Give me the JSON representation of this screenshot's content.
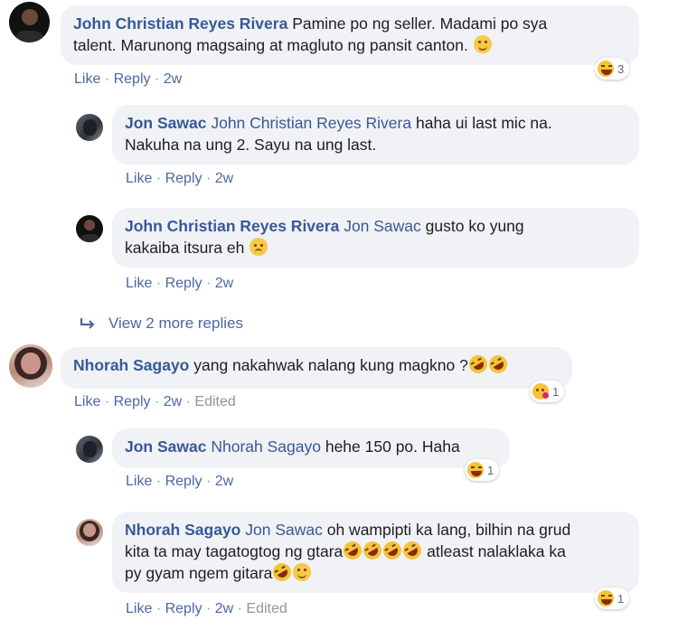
{
  "comments": [
    {
      "author": "John Christian Reyes Rivera",
      "text_line1": "Pamine po ng seller. Madami po sya",
      "text_line2": "talent. Marunong magsaing at magluto ng pansit canton.",
      "trail_emoji": "smile-emoji",
      "actions": {
        "like": "Like",
        "reply": "Reply",
        "time": "2w"
      },
      "reaction": {
        "icon": "laugh-reaction-icon",
        "count": "3"
      }
    },
    {
      "author": "Jon Sawac",
      "mention": "John Christian Reyes Rivera",
      "text_line1": "haha ui last mic na.",
      "text_line2": "Nakuha na ung 2. Sayu na ung last.",
      "actions": {
        "like": "Like",
        "reply": "Reply",
        "time": "2w"
      }
    },
    {
      "author": "John Christian Reyes Rivera",
      "mention": "Jon Sawac",
      "text_line1": "gusto ko yung",
      "text_line2": "kakaiba itsura eh",
      "trail_emoji": "sad-emoji",
      "actions": {
        "like": "Like",
        "reply": "Reply",
        "time": "2w"
      }
    },
    {
      "view_more": "View 2 more replies"
    },
    {
      "author": "Nhorah Sagayo",
      "text_line1": "yang nakahwak nalang kung magkno ?",
      "trail_emoji": "rofl-emoji",
      "actions": {
        "like": "Like",
        "reply": "Reply",
        "time": "2w",
        "edited": "Edited"
      },
      "reaction": {
        "icon": "wow-haha-reaction-icon",
        "count": "1"
      }
    },
    {
      "author": "Jon Sawac",
      "mention": "Nhorah Sagayo",
      "text_line1": "hehe 150 po. Haha",
      "actions": {
        "like": "Like",
        "reply": "Reply",
        "time": "2w"
      },
      "reaction": {
        "icon": "laugh-reaction-icon",
        "count": "1"
      }
    },
    {
      "author": "Nhorah Sagayo",
      "mention": "Jon Sawac",
      "text_line1": "oh wampipti ka lang, bilhin na grud",
      "text_line2a": "kita ta may tagatogtog ng gtara",
      "text_line2b": "atleast nalaklaka ka",
      "text_line3": "py gyam ngem gitara",
      "actions": {
        "like": "Like",
        "reply": "Reply",
        "time": "2w",
        "edited": "Edited"
      },
      "reaction": {
        "icon": "laugh-reaction-icon",
        "count": "1"
      }
    }
  ],
  "separator": "·"
}
